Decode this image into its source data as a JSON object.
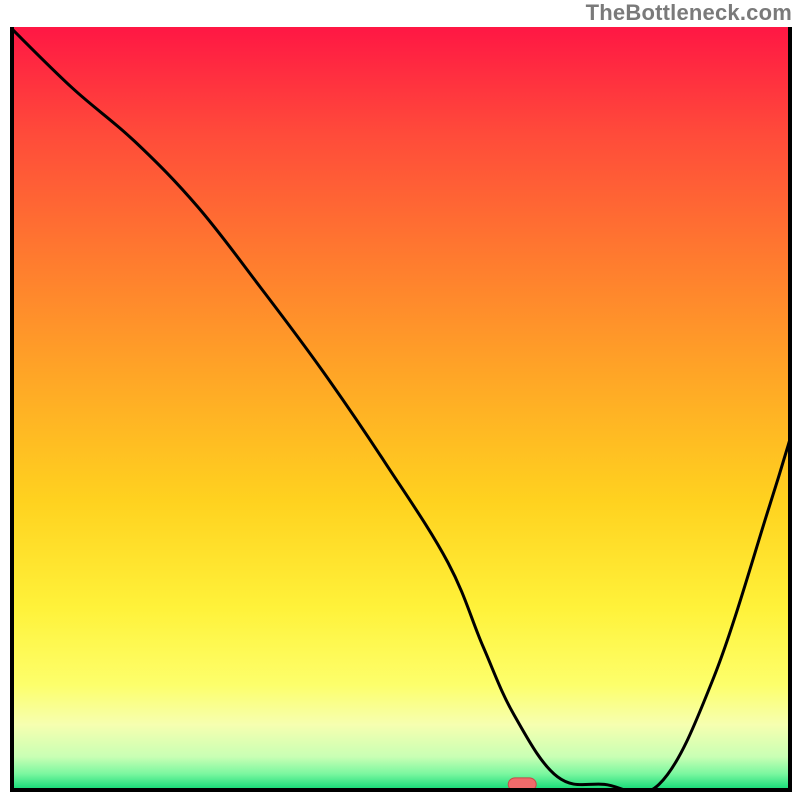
{
  "watermark": {
    "text": "TheBottleneck.com"
  },
  "colors": {
    "line": "#000000",
    "marker_fill": "#ef6a6a",
    "marker_stroke": "#c94848",
    "frame": "#000000"
  },
  "gradient_stops": [
    {
      "offset": 0.0,
      "color": "#ff1744"
    },
    {
      "offset": 0.14,
      "color": "#ff4b3a"
    },
    {
      "offset": 0.3,
      "color": "#ff7a2f"
    },
    {
      "offset": 0.46,
      "color": "#ffa726"
    },
    {
      "offset": 0.62,
      "color": "#ffd21f"
    },
    {
      "offset": 0.76,
      "color": "#fff23a"
    },
    {
      "offset": 0.86,
      "color": "#fdff6b"
    },
    {
      "offset": 0.912,
      "color": "#f6ffb0"
    },
    {
      "offset": 0.954,
      "color": "#c9ffb4"
    },
    {
      "offset": 0.976,
      "color": "#7cf7a0"
    },
    {
      "offset": 0.993,
      "color": "#25e07e"
    },
    {
      "offset": 1.0,
      "color": "#17cc6e"
    }
  ],
  "chart_data": {
    "type": "line",
    "title": "",
    "xlabel": "",
    "ylabel": "",
    "xlim": [
      0,
      100
    ],
    "ylim": [
      0,
      100
    ],
    "grid": false,
    "legend": false,
    "series": [
      {
        "name": "bottleneck-curve",
        "x": [
          0,
          8,
          16,
          24,
          32,
          40,
          48,
          56,
          60.5,
          64.5,
          70,
          76,
          83,
          90,
          97,
          100
        ],
        "values": [
          100,
          92,
          85,
          76.5,
          66,
          55,
          43,
          30,
          19,
          10,
          2,
          1,
          1,
          15,
          37,
          47
        ]
      }
    ],
    "annotations": [
      {
        "name": "optimal-marker",
        "x": 65.5,
        "y": 1,
        "shape": "pill"
      }
    ]
  }
}
